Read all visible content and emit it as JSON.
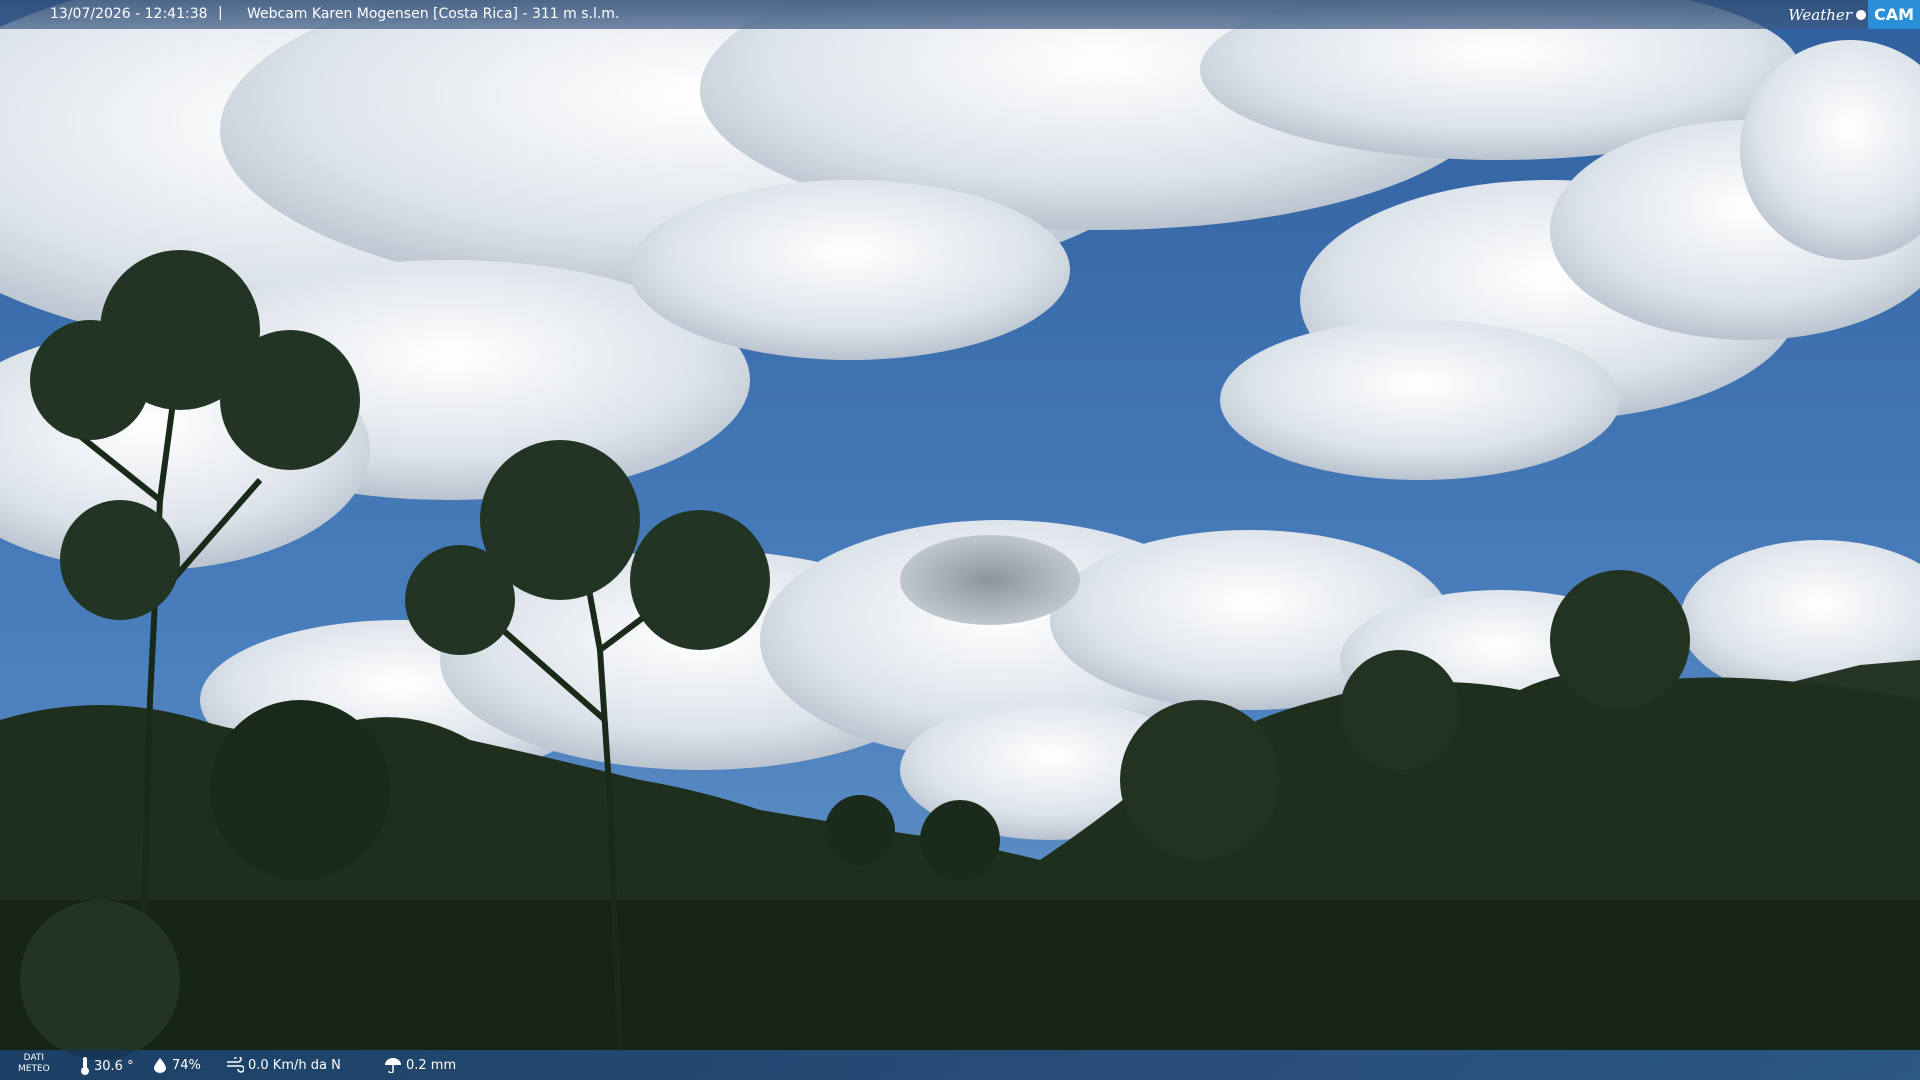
{
  "header": {
    "datetime": "13/07/2026 - 12:41:38",
    "separator": "|",
    "title": "Webcam Karen Mogensen [Costa Rica] - 311 m s.l.m.",
    "logo_weather": "Weather",
    "logo_cam": "CAM"
  },
  "footer": {
    "label_line1": "DATI",
    "label_line2": "METEO",
    "temperature": "30.6 °",
    "humidity": "74%",
    "wind": "0.0 Km/h da N",
    "rain": "0.2 mm",
    "icons": [
      "thermometer-icon",
      "humidity-icon",
      "wind-icon",
      "rain-icon"
    ]
  },
  "colors": {
    "sky": "#3f6fa8",
    "logo_accent": "#2a8fd6",
    "foliage": "#1c2d1c"
  }
}
